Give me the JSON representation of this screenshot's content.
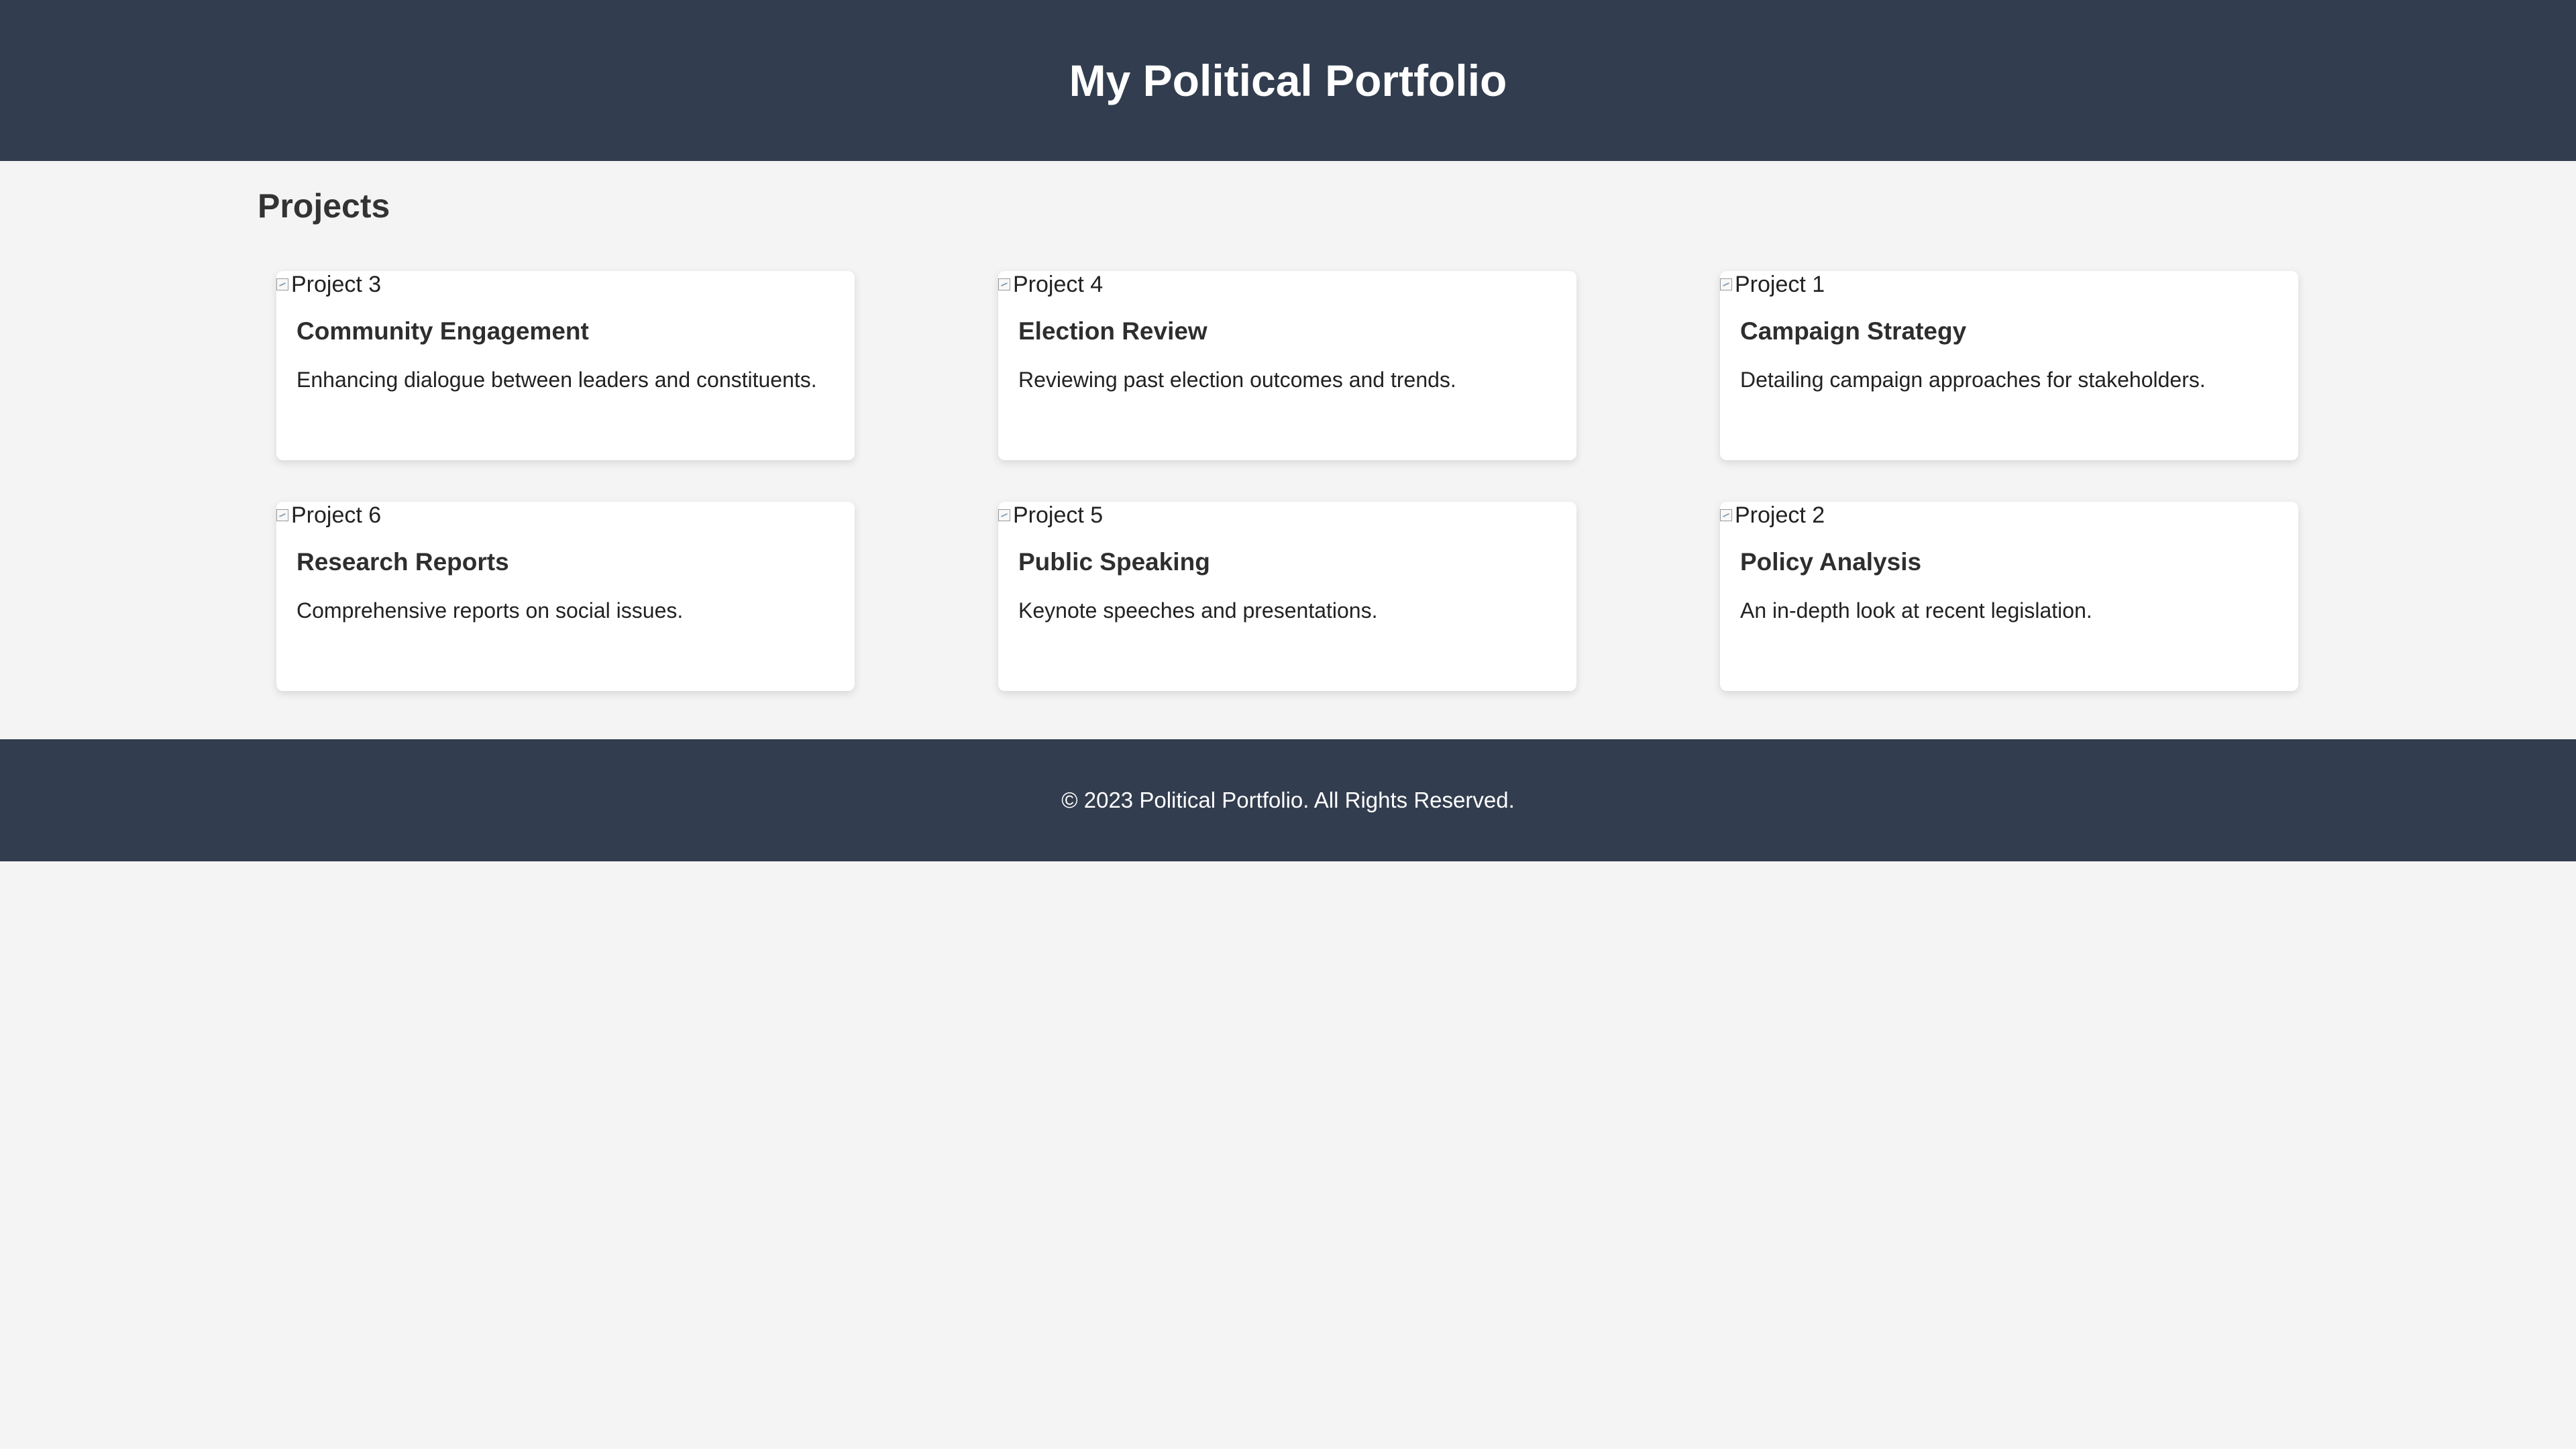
{
  "header": {
    "title": "My Political Portfolio"
  },
  "main": {
    "section_title": "Projects",
    "projects": [
      {
        "image_alt": "Project 3",
        "title": "Community Engagement",
        "description": "Enhancing dialogue between leaders and constituents."
      },
      {
        "image_alt": "Project 4",
        "title": "Election Review",
        "description": "Reviewing past election outcomes and trends."
      },
      {
        "image_alt": "Project 1",
        "title": "Campaign Strategy",
        "description": "Detailing campaign approaches for stakeholders."
      },
      {
        "image_alt": "Project 6",
        "title": "Research Reports",
        "description": "Comprehensive reports on social issues."
      },
      {
        "image_alt": "Project 5",
        "title": "Public Speaking",
        "description": "Keynote speeches and presentations."
      },
      {
        "image_alt": "Project 2",
        "title": "Policy Analysis",
        "description": "An in-depth look at recent legislation."
      }
    ]
  },
  "footer": {
    "text": "© 2023 Political Portfolio. All Rights Reserved."
  },
  "colors": {
    "header_background": "#323d4f",
    "page_background": "#f4f4f4",
    "card_background": "#ffffff",
    "text": "#2d2d2d",
    "header_text": "#ffffff"
  }
}
